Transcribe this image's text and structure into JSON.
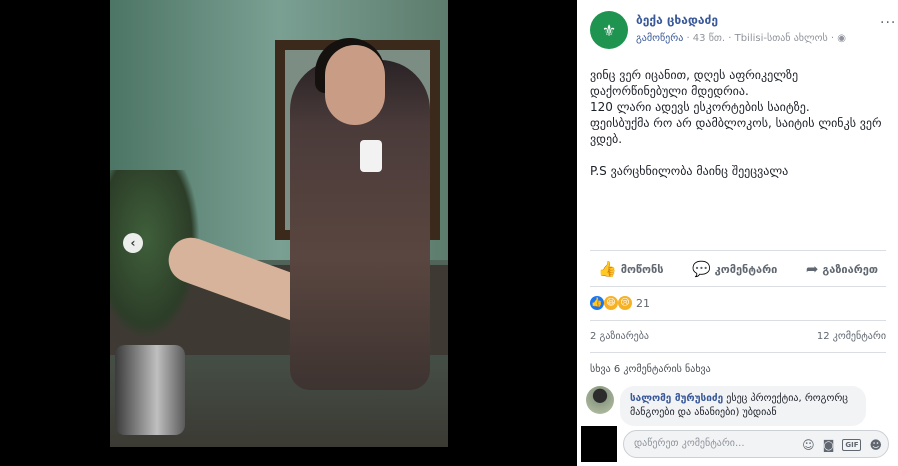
{
  "viewer": {
    "prev_arrow": "‹"
  },
  "page": {
    "name": "ბექა ცხადაძე",
    "avatar_icon": "trident-shield-icon",
    "meta_published": "გამოწერა",
    "meta_rest": " · 43 წთ. · Tbilisi-სთან ახლოს · ",
    "more": "···"
  },
  "post": {
    "lines": [
      "ვინც ვერ იცანით, დღეს აფრიკელზე",
      "დაქორწინებული მდედრია.",
      "120 ლარი ადევს ესკორტების საიტზე.",
      "ფეისბუქმა რო არ დამბლოკოს, საიტის ლინკს ვერ",
      "ვდებ."
    ],
    "ps": "P.S ვარცხნილობა მაინც შეეცვალა"
  },
  "actions": {
    "like": "მოწონს",
    "comment": "კომენტარი",
    "share": "გაზიარეთ"
  },
  "reactions": {
    "count": "21"
  },
  "stats": {
    "shares": "2 გაზიარება",
    "comments": "12 კომენტარი"
  },
  "comments": {
    "more_link": "სხვა 6 კომენტარის ნახვა",
    "first": {
      "author": "სალომე მურუსიძე",
      "text": " ესეც პროექტია, როგორც მანგოები და ანანიები) უბდიან"
    }
  },
  "composer": {
    "placeholder": "დაწერეთ კომენტარი...",
    "gif": "GIF"
  },
  "colors": {
    "link": "#385898",
    "brand_green": "#1e9450"
  }
}
